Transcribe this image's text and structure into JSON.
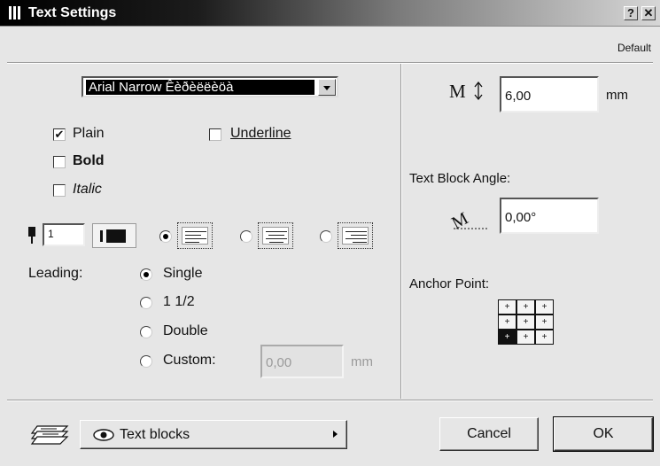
{
  "window": {
    "title": "Text Settings",
    "help_label": "?",
    "close_label": "✕"
  },
  "default_label": "Default",
  "font": {
    "selected": "Arial Narrow Êèðèëëèöà"
  },
  "styles": {
    "plain": {
      "label": "Plain",
      "checked": true
    },
    "bold": {
      "label": "Bold",
      "checked": false
    },
    "italic": {
      "label": "Italic",
      "checked": false
    },
    "underline": {
      "label": "Underline",
      "checked": false
    }
  },
  "pen": {
    "value": "1"
  },
  "alignment": {
    "options": [
      "left",
      "center",
      "right"
    ],
    "selected": "left"
  },
  "leading": {
    "label": "Leading:",
    "options": [
      {
        "label": "Single",
        "selected": true
      },
      {
        "label": "1 1/2",
        "selected": false
      },
      {
        "label": "Double",
        "selected": false
      },
      {
        "label": "Custom:",
        "selected": false
      }
    ],
    "custom_value": "0,00",
    "custom_unit": "mm"
  },
  "size": {
    "value": "6,00",
    "unit": "mm",
    "icon": "text-height-icon"
  },
  "angle": {
    "label": "Text Block Angle:",
    "value": "0,00°",
    "icon": "text-angle-icon"
  },
  "anchor": {
    "label": "Anchor Point:",
    "icon": "anchor-grid-icon"
  },
  "bottom": {
    "layer_icon": "layers-icon",
    "eye_icon": "eye-icon",
    "layer_menu_label": "Text blocks",
    "cancel_label": "Cancel",
    "ok_label": "OK"
  },
  "colors": {
    "title_bar_start": "#000000",
    "title_bar_end": "#d6d6d6",
    "dialog_bg": "#e6e6e6"
  }
}
